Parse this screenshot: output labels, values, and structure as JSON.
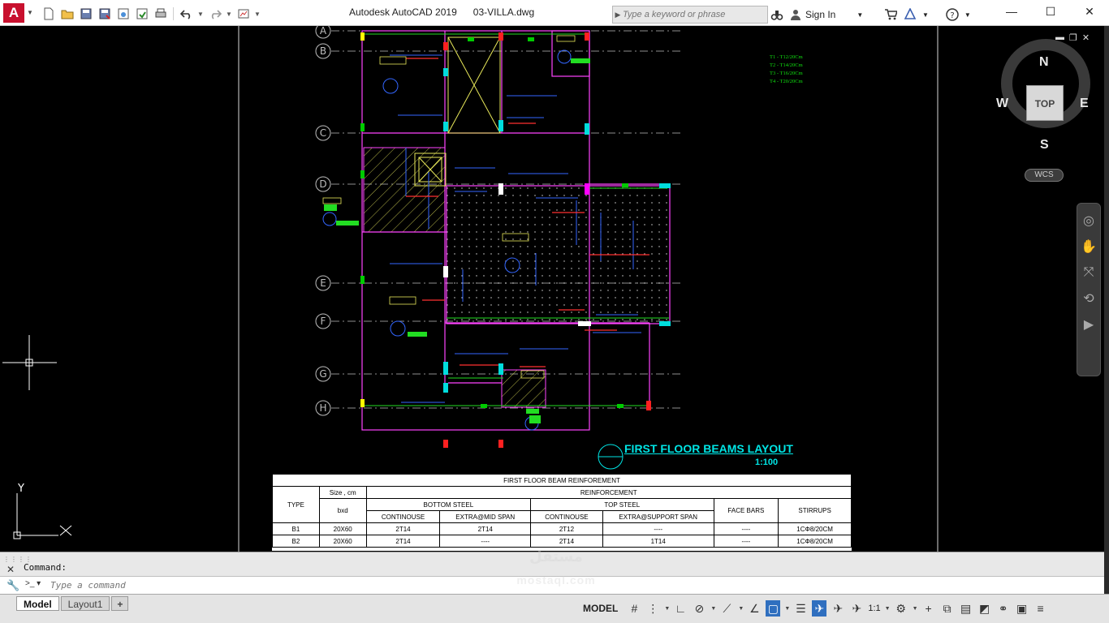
{
  "titlebar": {
    "app": "Autodesk AutoCAD 2019",
    "file": "03-VILLA.dwg",
    "search_placeholder": "Type a keyword or phrase",
    "signin": "Sign In"
  },
  "drawing": {
    "grid_labels": [
      "A",
      "B",
      "C",
      "D",
      "E",
      "F",
      "G",
      "H"
    ],
    "title": "FIRST FLOOR BEAMS LAYOUT",
    "scale": "1:100",
    "legend": [
      "T1 - T12/20Cm",
      "T2 - T14/20Cm",
      "T3 - T16/20Cm",
      "T4 - T20/20Cm"
    ]
  },
  "schedule": {
    "title": "FIRST FLOOR BEAM REINFOREMENT",
    "col_type": "TYPE",
    "col_size": "Size , cm",
    "col_bxd": "bxd",
    "col_reinforcement": "REINFORCEMENT",
    "col_bottom": "BOTTOM STEEL",
    "col_top": "TOP STEEL",
    "col_cont1": "CONTINOUSE",
    "col_extra_mid": "EXTRA@MID SPAN",
    "col_cont2": "CONTINOUSE",
    "col_extra_support": "EXTRA@SUPPORT SPAN",
    "col_face": "FACE BARS",
    "col_stirrups": "STIRRUPS",
    "rows": [
      [
        "B1",
        "20X60",
        "2T14",
        "2T14",
        "2T12",
        "----",
        "----",
        "1CΦ8/20CM"
      ],
      [
        "B2",
        "20X60",
        "2T14",
        "----",
        "2T14",
        "1T14",
        "----",
        "1CΦ8/20CM"
      ]
    ]
  },
  "viewcube": {
    "top": "TOP",
    "north": "N",
    "south": "S",
    "east": "E",
    "west": "W",
    "wcs": "WCS"
  },
  "ucs": {
    "x": "X",
    "y": "Y"
  },
  "command": {
    "history": "Command:",
    "placeholder": "Type a command"
  },
  "statusbar": {
    "tabs": [
      "Model",
      "Layout1"
    ],
    "add": "+",
    "model": "MODEL",
    "scale": "1:1"
  },
  "watermark": {
    "line1": "مستقل",
    "line2": "mostaql.com"
  }
}
